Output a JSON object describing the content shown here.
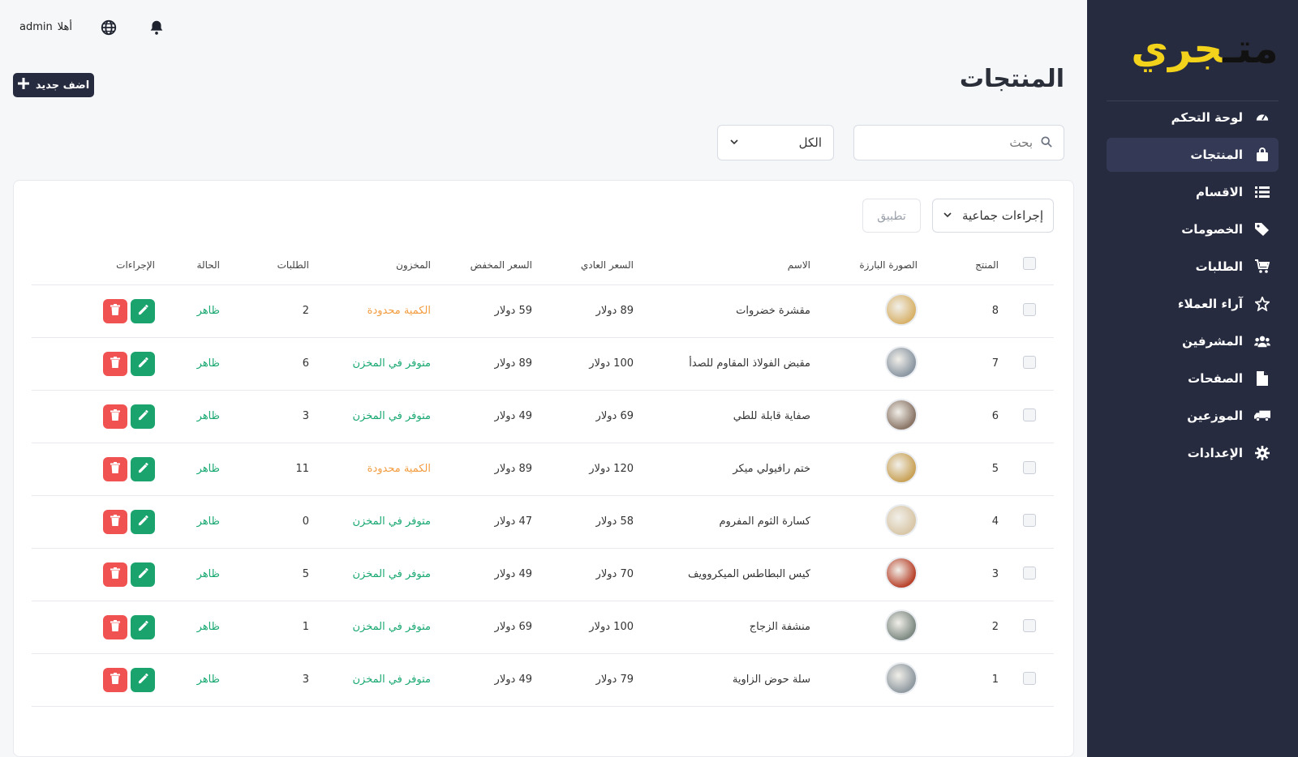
{
  "brand": {
    "logo_text_a": "متـ",
    "logo_text_b": "جري"
  },
  "sidebar": {
    "items": [
      {
        "label": "لوحة التحكم",
        "icon": "gauge-icon",
        "active": false
      },
      {
        "label": "المنتجات",
        "icon": "shopping-bag-icon",
        "active": true
      },
      {
        "label": "الاقسام",
        "icon": "list-icon",
        "active": false
      },
      {
        "label": "الخصومات",
        "icon": "tags-icon",
        "active": false
      },
      {
        "label": "الطلبات",
        "icon": "cart-icon",
        "active": false
      },
      {
        "label": "آراء العملاء",
        "icon": "star-icon",
        "active": false
      },
      {
        "label": "المشرفين",
        "icon": "users-icon",
        "active": false
      },
      {
        "label": "الصفحات",
        "icon": "file-icon",
        "active": false
      },
      {
        "label": "الموزعين",
        "icon": "truck-icon",
        "active": false
      },
      {
        "label": "الإعدادات",
        "icon": "gear-icon",
        "active": false
      }
    ]
  },
  "topbar": {
    "greeting": "أهلا",
    "username": "admin"
  },
  "page": {
    "title": "المنتجات",
    "add_label": "اضف جديد",
    "search_placeholder": "بحث",
    "filter_value": "الكل"
  },
  "bulk": {
    "label": "إجراءات جماعية",
    "apply_label": "تطبيق"
  },
  "table": {
    "headers": {
      "product": "المنتج",
      "image": "الصورة البارزة",
      "name": "الاسم",
      "regular_price": "السعر العادي",
      "sale_price": "السعر المخفض",
      "stock": "المخزون",
      "orders": "الطلبات",
      "status": "الحالة",
      "actions": "الإجراءات"
    },
    "rows": [
      {
        "id": "8",
        "name": "مقشرة خضروات",
        "regular": "89 دولار",
        "sale": "59 دولار",
        "stock": "الكمية محدودة",
        "stock_kind": "limited",
        "orders": "2",
        "status": "ظاهر",
        "thumb_color": "#d8b26a"
      },
      {
        "id": "7",
        "name": "مقبض الفولاذ المقاوم للصدأ",
        "regular": "100 دولار",
        "sale": "89 دولار",
        "stock": "متوفر في المخزن",
        "stock_kind": "ok",
        "orders": "6",
        "status": "ظاهر",
        "thumb_color": "#8b97a3"
      },
      {
        "id": "6",
        "name": "صفاية قابلة للطي",
        "regular": "69 دولار",
        "sale": "49 دولار",
        "stock": "متوفر في المخزن",
        "stock_kind": "ok",
        "orders": "3",
        "status": "ظاهر",
        "thumb_color": "#8a7566"
      },
      {
        "id": "5",
        "name": "ختم رافيولي ميكر",
        "regular": "120 دولار",
        "sale": "89 دولار",
        "stock": "الكمية محدودة",
        "stock_kind": "limited",
        "orders": "11",
        "status": "ظاهر",
        "thumb_color": "#c9a257"
      },
      {
        "id": "4",
        "name": "كسارة الثوم المفروم",
        "regular": "58 دولار",
        "sale": "47 دولار",
        "stock": "متوفر في المخزن",
        "stock_kind": "ok",
        "orders": "0",
        "status": "ظاهر",
        "thumb_color": "#d9c7a8"
      },
      {
        "id": "3",
        "name": "كيس البطاطس الميكروويف",
        "regular": "70 دولار",
        "sale": "49 دولار",
        "stock": "متوفر في المخزن",
        "stock_kind": "ok",
        "orders": "5",
        "status": "ظاهر",
        "thumb_color": "#b8432c"
      },
      {
        "id": "2",
        "name": "منشفة الزجاج",
        "regular": "100 دولار",
        "sale": "69 دولار",
        "stock": "متوفر في المخزن",
        "stock_kind": "ok",
        "orders": "1",
        "status": "ظاهر",
        "thumb_color": "#7e8a83"
      },
      {
        "id": "1",
        "name": "سلة حوض الزاوية",
        "regular": "79 دولار",
        "sale": "49 دولار",
        "stock": "متوفر في المخزن",
        "stock_kind": "ok",
        "orders": "3",
        "status": "ظاهر",
        "thumb_color": "#909aa1"
      }
    ]
  },
  "colors": {
    "sidebar_bg": "#272b3f",
    "accent_yellow": "#f3d21b",
    "success": "#18a871",
    "warning": "#f29c3f",
    "danger": "#f05252"
  }
}
